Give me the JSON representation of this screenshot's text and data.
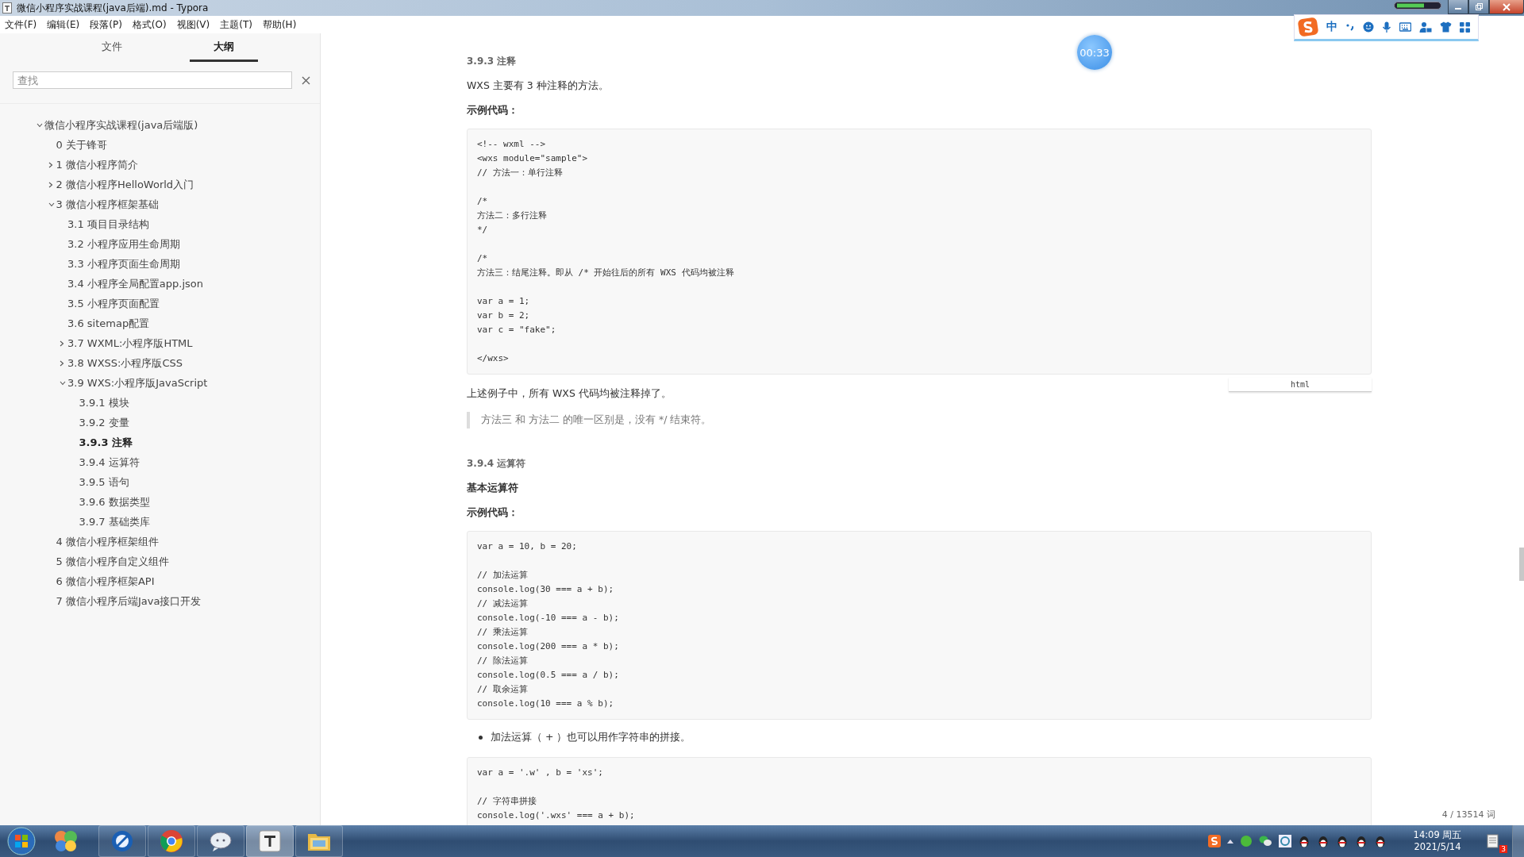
{
  "window": {
    "title": "微信小程序实战课程(java后端).md - Typora"
  },
  "menu": [
    "文件(F)",
    "编辑(E)",
    "段落(P)",
    "格式(O)",
    "视图(V)",
    "主题(T)",
    "帮助(H)"
  ],
  "sidebar": {
    "tabs": [
      {
        "label": "文件",
        "selected": false
      },
      {
        "label": "大纲",
        "selected": true
      }
    ],
    "search": {
      "placeholder": "查找"
    },
    "outline": [
      {
        "label": "微信小程序实战课程(java后端版)",
        "expanded": true,
        "selected": false,
        "children": [
          {
            "label": "0 关于锋哥",
            "selected": false
          },
          {
            "label": "1 微信小程序简介",
            "expanded": false,
            "selected": false
          },
          {
            "label": "2 微信小程序HelloWorld入门",
            "expanded": false,
            "selected": false
          },
          {
            "label": "3 微信小程序框架基础",
            "expanded": true,
            "selected": false,
            "children": [
              {
                "label": "3.1 项目目录结构",
                "selected": false
              },
              {
                "label": "3.2 小程序应用生命周期",
                "selected": false
              },
              {
                "label": "3.3 小程序页面生命周期",
                "selected": false
              },
              {
                "label": "3.4 小程序全局配置app.json",
                "selected": false
              },
              {
                "label": "3.5 小程序页面配置",
                "selected": false
              },
              {
                "label": "3.6 sitemap配置",
                "selected": false
              },
              {
                "label": "3.7 WXML:小程序版HTML",
                "expanded": false,
                "selected": false
              },
              {
                "label": "3.8 WXSS:小程序版CSS",
                "expanded": false,
                "selected": false
              },
              {
                "label": "3.9 WXS:小程序版JavaScript",
                "expanded": true,
                "selected": false,
                "children": [
                  {
                    "label": "3.9.1 模块",
                    "selected": false
                  },
                  {
                    "label": "3.9.2 变量",
                    "selected": false
                  },
                  {
                    "label": "3.9.3 注释",
                    "selected": true
                  },
                  {
                    "label": "3.9.4 运算符",
                    "selected": false
                  },
                  {
                    "label": "3.9.5 语句",
                    "selected": false
                  },
                  {
                    "label": "3.9.6 数据类型",
                    "selected": false
                  },
                  {
                    "label": "3.9.7 基础类库",
                    "selected": false
                  }
                ]
              }
            ]
          },
          {
            "label": "4 微信小程序框架组件",
            "selected": false
          },
          {
            "label": "5 微信小程序自定义组件",
            "selected": false
          },
          {
            "label": "6 微信小程序框架API",
            "selected": false
          },
          {
            "label": "7 微信小程序后端Java接口开发",
            "selected": false
          }
        ]
      }
    ]
  },
  "timer": "00:33",
  "content": [
    {
      "kind": "heading",
      "text": "3.9.3 注释"
    },
    {
      "kind": "paragraph",
      "text": "WXS 主要有 3 种注释的方法。"
    },
    {
      "kind": "strong",
      "text": "示例代码："
    },
    {
      "kind": "code",
      "lang": "html",
      "groups": [
        [
          "<!-- wxml -->",
          "<wxs module=\"sample\">",
          "// 方法一：单行注释"
        ],
        [
          "/*",
          "方法二：多行注释",
          "*/"
        ],
        [
          "/*",
          "方法三：结尾注释。即从 /* 开始往后的所有 WXS 代码均被注释"
        ],
        [
          "var a = 1;",
          "var b = 2;",
          "var c = \"fake\";"
        ],
        [
          "</wxs>"
        ]
      ]
    },
    {
      "kind": "paragraph",
      "text": "上述例子中，所有 WXS 代码均被注释掉了。"
    },
    {
      "kind": "quote",
      "text": "方法三 和 方法二 的唯一区别是，没有 */ 结束符。"
    },
    {
      "kind": "heading",
      "text": "3.9.4 运算符"
    },
    {
      "kind": "strong",
      "text": "基本运算符"
    },
    {
      "kind": "strong",
      "text": "示例代码："
    },
    {
      "kind": "code",
      "groups": [
        [
          "var a = 10, b = 20;"
        ],
        [
          "// 加法运算",
          "console.log(30 === a + b);",
          "// 减法运算",
          "console.log(-10 === a - b);",
          "// 乘法运算",
          "console.log(200 === a * b);",
          "// 除法运算",
          "console.log(0.5 === a / b);",
          "// 取余运算",
          "console.log(10 === a % b);"
        ]
      ]
    },
    {
      "kind": "bullet",
      "text": "加法运算（ + ）也可以用作字符串的拼接。"
    },
    {
      "kind": "code",
      "groups": [
        [
          "var a = '.w' , b = 'xs';"
        ],
        [
          "// 字符串拼接",
          "console.log('.wxs' === a + b);"
        ]
      ]
    }
  ],
  "word_count": "4 / 13514 词",
  "ime": {
    "mode": "中"
  },
  "taskbar": {
    "time": "14:09 周五",
    "date": "2021/5/14",
    "notifications": "3"
  }
}
